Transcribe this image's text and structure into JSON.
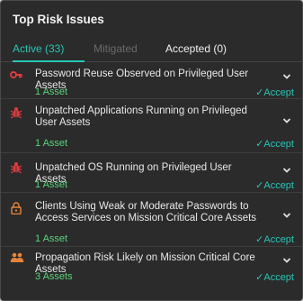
{
  "panel": {
    "title": "Top Risk Issues"
  },
  "tabs": [
    {
      "label": "Active (33)"
    },
    {
      "label": "Mitigated"
    },
    {
      "label": "Accepted (0)"
    }
  ],
  "colors": {
    "accent": "#27c4b4",
    "asset_green": "#58d47a",
    "severity_red": "#e03a3e",
    "severity_orange": "#e8843a"
  },
  "issues": [
    {
      "icon": "key-icon",
      "title": "Password Reuse Observed on Privileged User Assets",
      "assets": "1 Asset",
      "accept": "✓Accept"
    },
    {
      "icon": "bug-icon",
      "title": "Unpatched Applications Running on Privileged User Assets",
      "assets": "1 Asset",
      "accept": "✓Accept"
    },
    {
      "icon": "bug-icon",
      "title": "Unpatched OS Running on Privileged User Assets",
      "assets": "1 Asset",
      "accept": "✓Accept"
    },
    {
      "icon": "lock-icon",
      "title": "Clients Using Weak or Moderate Passwords to Access Services on Mission Critical Core Assets",
      "assets": "1 Asset",
      "accept": "✓Accept"
    },
    {
      "icon": "users-icon",
      "title": "Propagation Risk Likely on Mission Critical Core Assets",
      "assets": "3 Assets",
      "accept": "✓Accept"
    }
  ]
}
